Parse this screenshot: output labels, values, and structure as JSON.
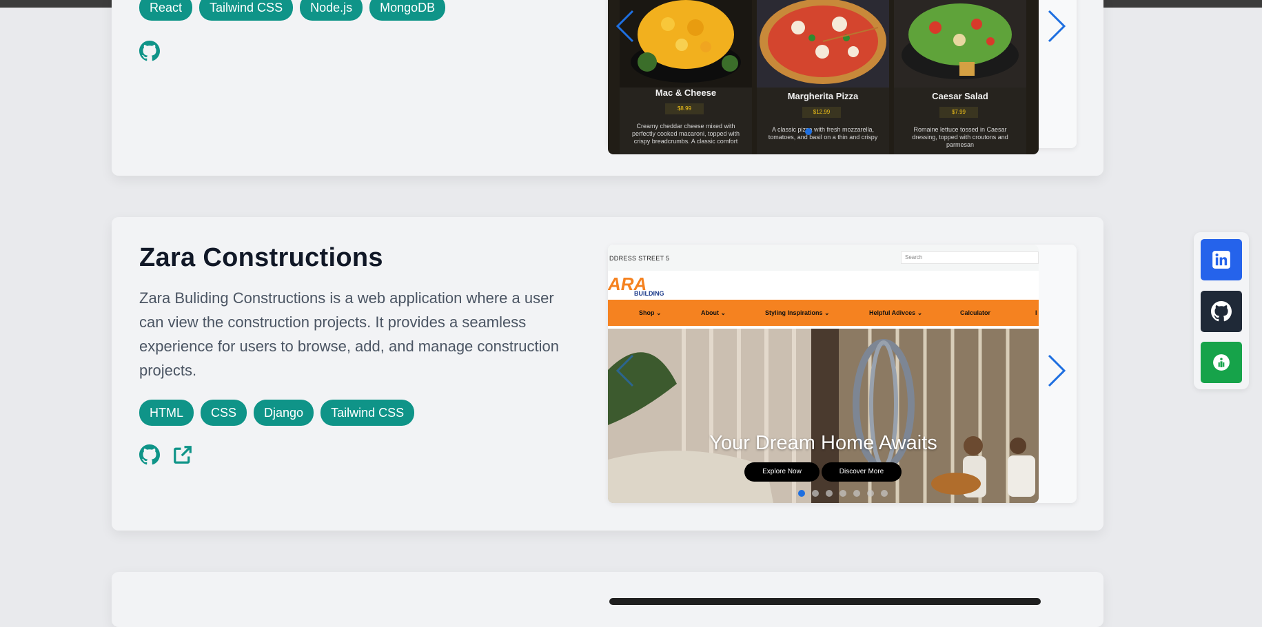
{
  "projects": [
    {
      "tags": [
        "React",
        "Tailwind CSS",
        "Node.js",
        "MongoDB"
      ],
      "slide": {
        "items": [
          {
            "name": "Mac & Cheese",
            "price": "$8.99",
            "desc": "Creamy cheddar cheese mixed with perfectly cooked macaroni, topped with crispy breadcrumbs. A classic comfort"
          },
          {
            "name": "Margherita Pizza",
            "price": "$12.99",
            "desc": "A classic pizza with fresh mozzarella, tomatoes, and basil on a thin and crispy"
          },
          {
            "name": "Caesar Salad",
            "price": "$7.99",
            "desc": "Romaine lettuce tossed in Caesar dressing, topped with croutons and parmesan"
          }
        ]
      }
    },
    {
      "title": "Zara Constructions",
      "description": "Zara Buliding Constructions is a web application where a user can view the construction projects. It provides a seamless experience for users to browse, add, and manage construction projects.",
      "tags": [
        "HTML",
        "CSS",
        "Django",
        "Tailwind CSS"
      ],
      "slide": {
        "address": "DDRESS STREET 5",
        "search_placeholder": "Search",
        "logo_text": "ARA",
        "logo_sub": "BUILDING",
        "menu": [
          "Shop",
          "About",
          "Styling Inspirations",
          "Helpful Adivces",
          "Calculator"
        ],
        "hero_title": "Your Dream Home Awaits",
        "buttons": [
          "Explore Now",
          "Discover More"
        ],
        "dots_total": 7,
        "dots_active": 1
      }
    }
  ],
  "social": [
    "linkedin-icon",
    "github-icon",
    "resume-icon"
  ],
  "colors": {
    "tag": "#0f9488",
    "accent": "#1e6fe0",
    "menu": "#f58220",
    "linkedin": "#2563eb",
    "github": "#1f2937",
    "resume": "#16a34a"
  }
}
